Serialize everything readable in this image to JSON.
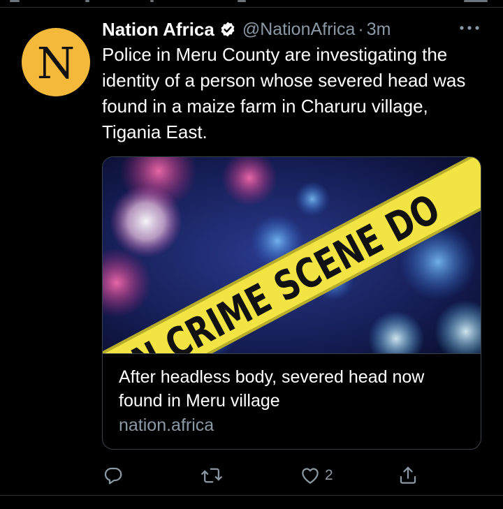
{
  "tweet": {
    "author": {
      "avatar_letter": "N",
      "display_name": "Nation Africa",
      "handle": "@NationAfrica",
      "separator": "·",
      "time": "3m",
      "verified": true
    },
    "text": "Police in Meru County are investigating the identity of a person whose severed head was found in a maize farm in Charuru village, Tigania East.",
    "card": {
      "image_text": "N CRIME SCENE DO",
      "title": "After headless body, severed head now found in Meru village",
      "domain": "nation.africa"
    },
    "actions": {
      "reply_count": "",
      "retweet_count": "",
      "like_count": "2",
      "share_count": ""
    }
  },
  "icons": {
    "verified": "verified-badge-icon",
    "more": "more-options-icon",
    "reply": "reply-icon",
    "retweet": "retweet-icon",
    "like": "heart-icon",
    "share": "share-icon"
  },
  "colors": {
    "background": "#000000",
    "text_primary": "#ffffff",
    "text_secondary": "#8b98a5",
    "border": "#38444d",
    "avatar": "#f4b93a",
    "tape": "#f1e443"
  }
}
